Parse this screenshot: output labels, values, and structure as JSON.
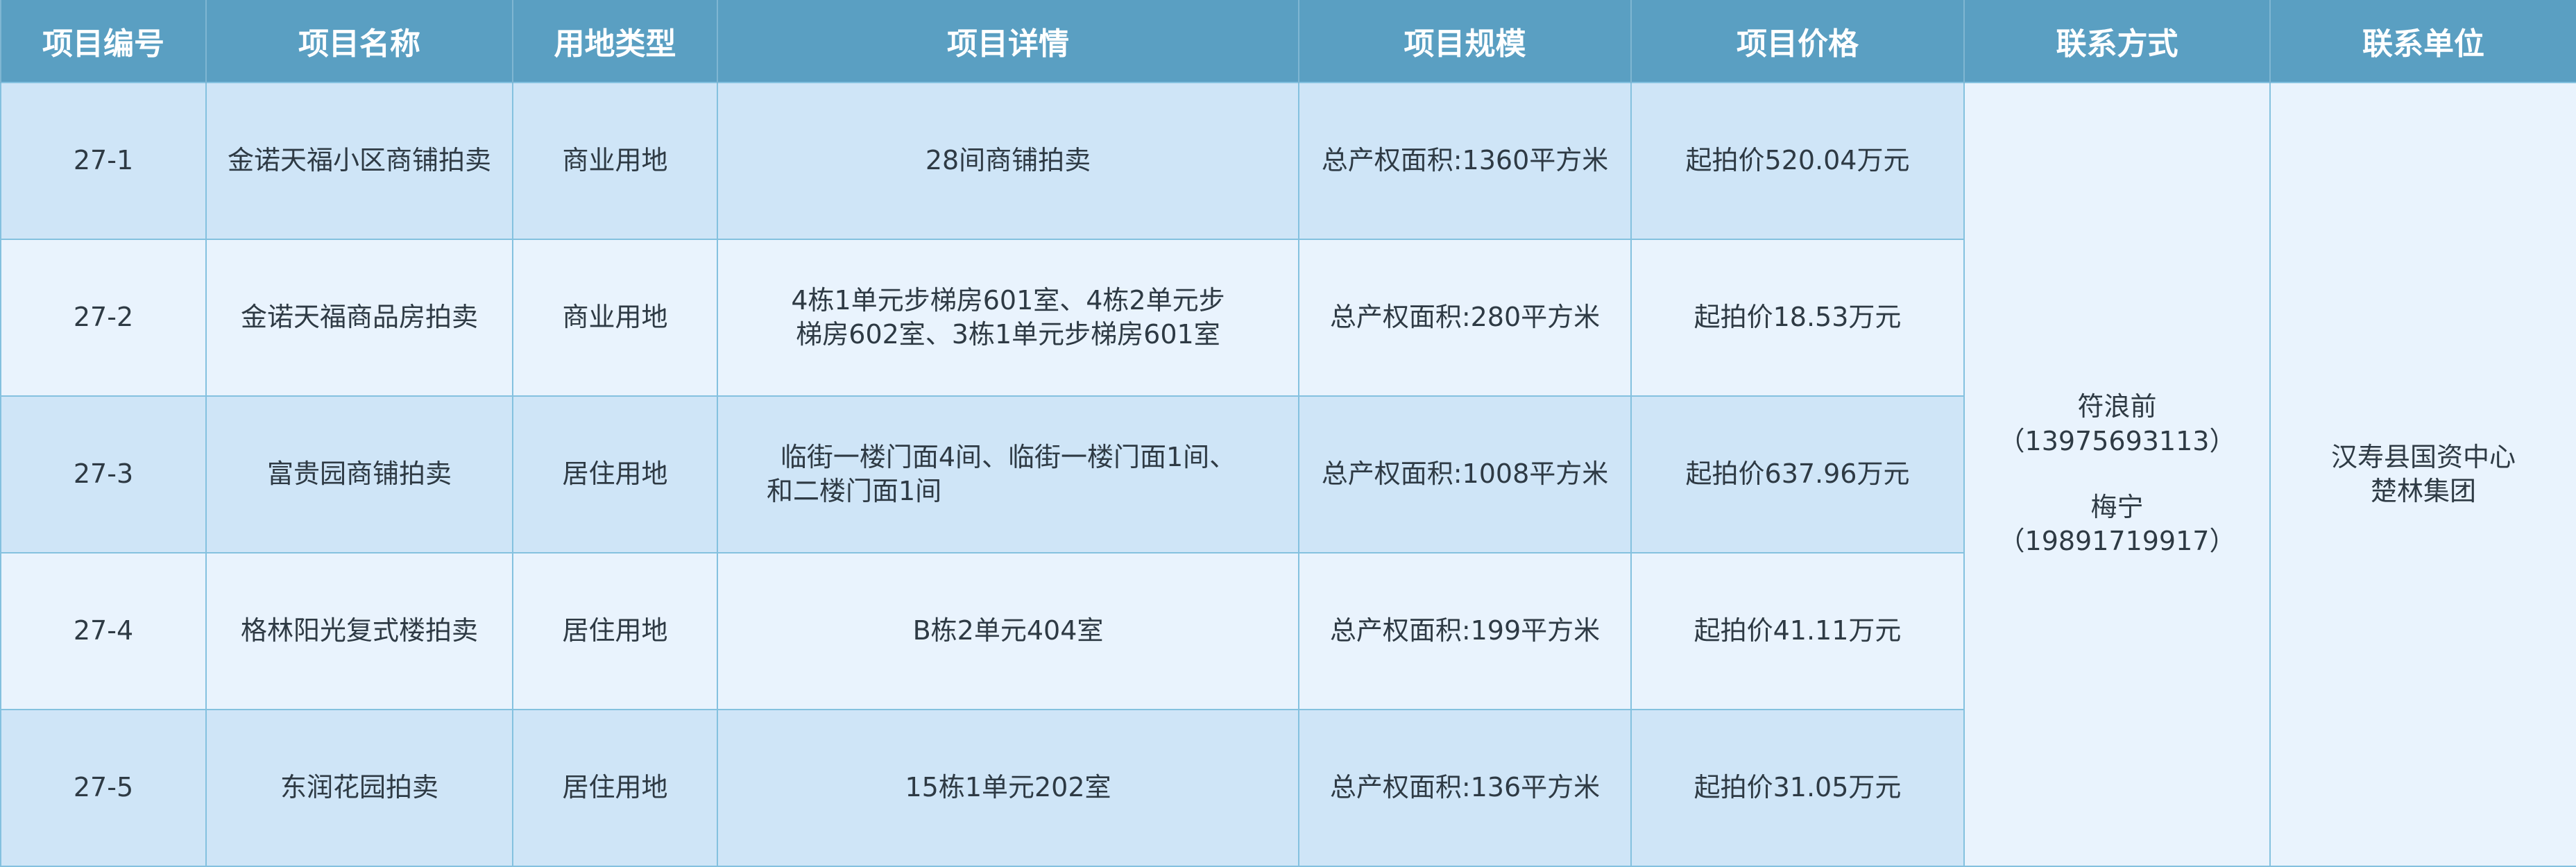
{
  "headers": [
    "项目编号",
    "项目名称",
    "用地类型",
    "项目详情",
    "项目规模",
    "项目价格",
    "联系方式",
    "联系单位"
  ],
  "rows": [
    {
      "id": "27-1",
      "name": "金诺天福小区商铺拍卖",
      "land_type": "商业用地",
      "detail_lines": [
        "28间商铺拍卖"
      ],
      "scale": "总产权面积:1360平方米",
      "price": "起拍价520.04万元"
    },
    {
      "id": "27-2",
      "name": "金诺天福商品房拍卖",
      "land_type": "商业用地",
      "detail_lines": [
        "4栋1单元步梯房601室、4栋2单元步",
        "梯房602室、3栋1单元步梯房601室"
      ],
      "scale": "总产权面积:280平方米",
      "price": "起拍价18.53万元"
    },
    {
      "id": "27-3",
      "name": "富贵园商铺拍卖",
      "land_type": "居住用地",
      "detail_lines": [
        "临街一楼门面4间、临街一楼门面1间、",
        "和二楼门面1间"
      ],
      "scale": "总产权面积:1008平方米",
      "price": "起拍价637.96万元"
    },
    {
      "id": "27-4",
      "name": "格林阳光复式楼拍卖",
      "land_type": "居住用地",
      "detail_lines": [
        "B栋2单元404室"
      ],
      "scale": "总产权面积:199平方米",
      "price": "起拍价41.11万元"
    },
    {
      "id": "27-5",
      "name": "东润花园拍卖",
      "land_type": "居住用地",
      "detail_lines": [
        "15栋1单元202室"
      ],
      "scale": "总产权面积:136平方米",
      "price": "起拍价31.05万元"
    }
  ],
  "contact": {
    "person1": "符浪前",
    "phone1": "（13975693113）",
    "person2": "梅宁",
    "phone2": "（19891719917）"
  },
  "unit": {
    "line1": "汉寿县国资中心",
    "line2": "楚林集团"
  }
}
